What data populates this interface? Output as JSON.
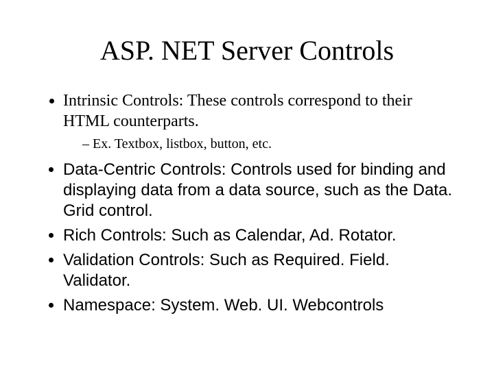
{
  "title": "ASP. NET Server Controls",
  "bullets": {
    "b1": "Intrinsic Controls: These controls correspond to their HTML counterparts.",
    "b1_sub1": "Ex. Textbox, listbox, button, etc.",
    "b2": "Data-Centric Controls: Controls used for binding and displaying data from a data source, such as the Data. Grid control.",
    "b3": "Rich Controls: Such as Calendar, Ad. Rotator.",
    "b4": "Validation Controls: Such as Required. Field. Validator.",
    "b5": "Namespace: System. Web. UI. Webcontrols"
  }
}
